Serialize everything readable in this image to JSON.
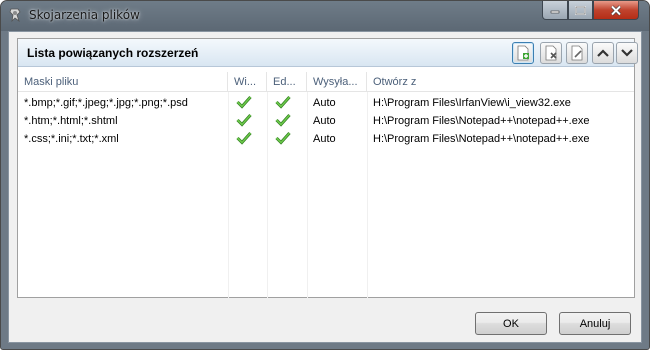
{
  "window": {
    "title": "Skojarzenia plików"
  },
  "panel": {
    "title": "Lista powiązanych rozszerzeń",
    "toolbar": [
      "add-icon",
      "remove-icon",
      "edit-icon",
      "move-up-icon",
      "move-down-icon"
    ]
  },
  "table": {
    "columns": [
      "Maski pliku",
      "Wi...",
      "Ed...",
      "Wysyła...",
      "Otwórz z"
    ],
    "rows": [
      {
        "masks": "*.bmp;*.gif;*.jpeg;*.jpg;*.png;*.psd",
        "view": true,
        "edit": true,
        "send": "Auto",
        "open_with": "H:\\Program Files\\IrfanView\\i_view32.exe"
      },
      {
        "masks": "*.htm;*.html;*.shtml",
        "view": true,
        "edit": true,
        "send": "Auto",
        "open_with": "H:\\Program Files\\Notepad++\\notepad++.exe"
      },
      {
        "masks": "*.css;*.ini;*.txt;*.xml",
        "view": true,
        "edit": true,
        "send": "Auto",
        "open_with": "H:\\Program Files\\Notepad++\\notepad++.exe"
      }
    ]
  },
  "buttons": {
    "ok": "OK",
    "cancel": "Anuluj"
  },
  "colors": {
    "header_gradient_top": "#f4f8fc",
    "header_gradient_bottom": "#d9e6f2",
    "column_header_text": "#4c607a",
    "check_green": "#3d9a2a"
  }
}
